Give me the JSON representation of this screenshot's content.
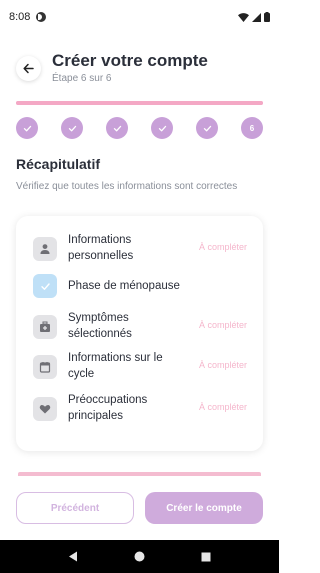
{
  "status_bar": {
    "time": "8:08"
  },
  "header": {
    "title": "Créer votre compte",
    "subtitle": "Étape 6 sur 6",
    "progress": 1.0
  },
  "steps": [
    {
      "state": "done",
      "label": ""
    },
    {
      "state": "done",
      "label": ""
    },
    {
      "state": "done",
      "label": ""
    },
    {
      "state": "done",
      "label": ""
    },
    {
      "state": "done",
      "label": ""
    },
    {
      "state": "current",
      "label": "6"
    }
  ],
  "summary": {
    "title": "Récapitulatif",
    "description": "Vérifiez que toutes les informations sont correctes",
    "items": [
      {
        "label": "Informations personnelles",
        "status": "À compléter",
        "icon": "person-icon"
      },
      {
        "label": "Phase de ménopause",
        "status": "",
        "icon": "check-icon"
      },
      {
        "label": "Symptômes sélectionnés",
        "status": "À compléter",
        "icon": "medical-bag-icon"
      },
      {
        "label": "Informations sur le cycle",
        "status": "À compléter",
        "icon": "calendar-icon"
      },
      {
        "label": "Préoccupations principales",
        "status": "À compléter",
        "icon": "heart-icon"
      }
    ]
  },
  "actions": {
    "previous_label": "Précédent",
    "create_label": "Créer le compte"
  },
  "colors": {
    "accent": "#cfabdc",
    "progress": "#f4a8c5",
    "pending": "#f5b6cc"
  }
}
